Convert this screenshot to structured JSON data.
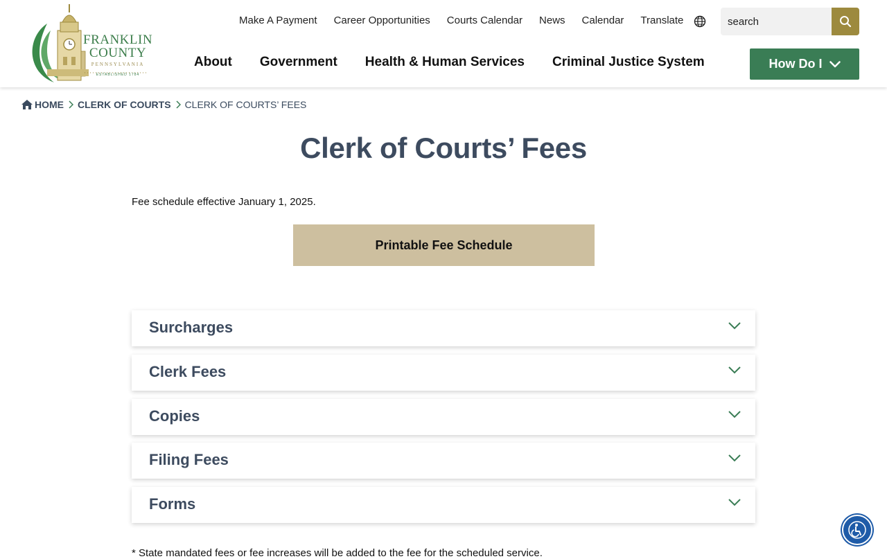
{
  "logo": {
    "line1": "FRANKLIN",
    "line2": "COUNTY",
    "line3": "PENNSYLVANIA",
    "line4": "ESTABLISHED 1784"
  },
  "utility_nav": [
    {
      "label": "Make A Payment"
    },
    {
      "label": "Career Opportunities"
    },
    {
      "label": "Courts Calendar"
    },
    {
      "label": "News"
    },
    {
      "label": "Calendar"
    },
    {
      "label": "Translate"
    }
  ],
  "icons": {
    "globe": "globe-icon",
    "search": "search-icon",
    "home": "home-icon",
    "chevron": "chevron-down-icon",
    "accessibility": "accessibility-icon"
  },
  "search": {
    "placeholder": "search"
  },
  "main_nav": [
    {
      "label": "About"
    },
    {
      "label": "Government"
    },
    {
      "label": "Health & Human Services"
    },
    {
      "label": "Criminal Justice System"
    }
  ],
  "how_do_i": {
    "label": "How Do I"
  },
  "breadcrumb": {
    "home": "HOME",
    "parent": "CLERK OF COURTS",
    "current": "CLERK OF COURTS’ FEES"
  },
  "page": {
    "title": "Clerk of Courts’ Fees",
    "intro": "Fee schedule effective January 1, 2025.",
    "print_button": "Printable Fee Schedule",
    "footnote": "* State mandated fees or fee increases will be added to the fee for the scheduled service."
  },
  "accordions": [
    {
      "title": "Surcharges"
    },
    {
      "title": "Clerk Fees"
    },
    {
      "title": "Copies"
    },
    {
      "title": "Filing Fees"
    },
    {
      "title": "Forms"
    }
  ],
  "colors": {
    "accent_green": "#3a7d55",
    "search_gold": "#9d8a3e",
    "print_tan": "#cdbf9f",
    "heading_slate": "#3d4b5f"
  }
}
